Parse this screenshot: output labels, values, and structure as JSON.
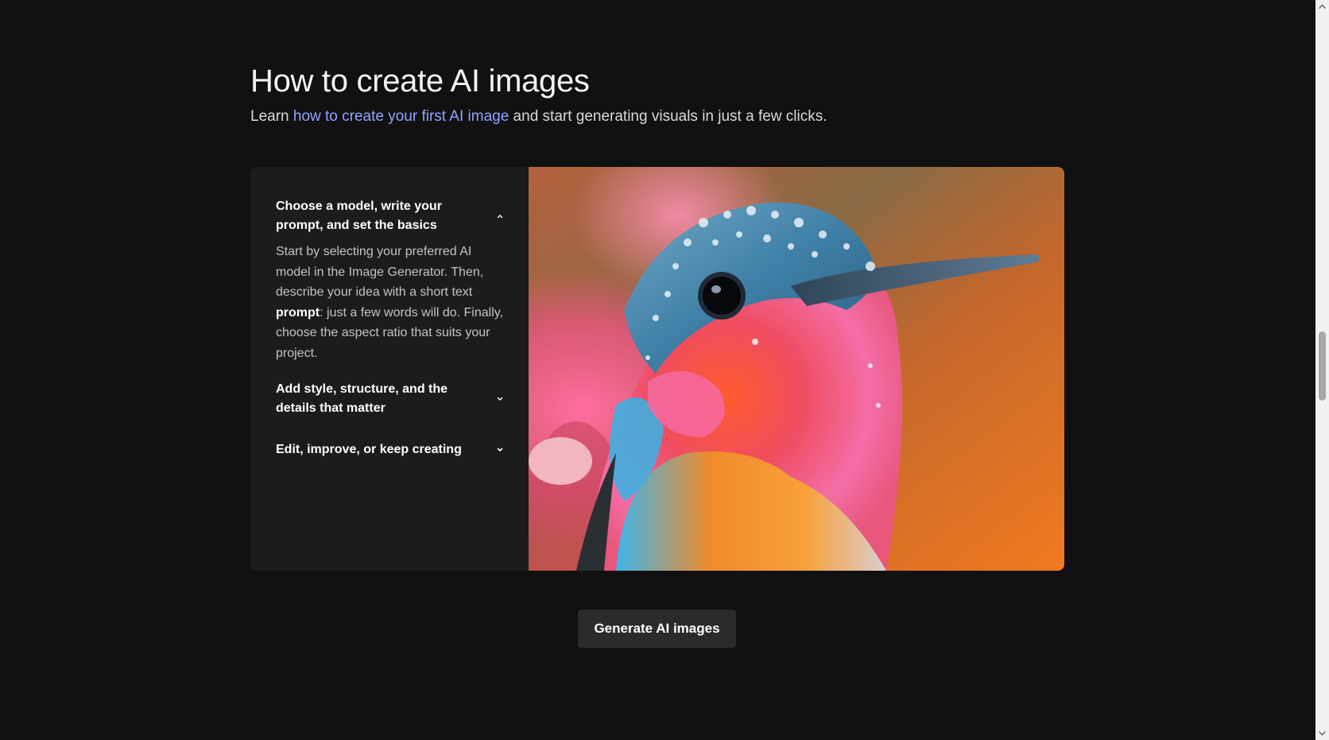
{
  "section": {
    "title": "How to create AI images",
    "intro_prefix": "Learn ",
    "intro_link": "how to create your first AI image",
    "intro_suffix": " and start generating visuals in just a few clicks."
  },
  "accordion": {
    "items": [
      {
        "title": "Choose a model, write your prompt, and set the basics",
        "expanded": true,
        "icon": "chevron-up-icon",
        "body_part1": "Start by selecting your preferred AI model in the Image Generator. Then, describe your idea with a short text ",
        "body_bold": "prompt",
        "body_part2": ": just a few words will do. Finally, choose the aspect ratio that suits your project."
      },
      {
        "title": "Add style, structure, and the details that matter",
        "expanded": false,
        "icon": "chevron-down-icon"
      },
      {
        "title": "Edit, improve, or keep creating",
        "expanded": false,
        "icon": "chevron-down-icon"
      }
    ]
  },
  "image": {
    "subject": "close-up of a colorful hummingbird covered in water droplets"
  },
  "cta": {
    "label": "Generate AI images"
  },
  "colors": {
    "background": "#111112",
    "card": "#1c1c1d",
    "link": "#8ea6ff",
    "button": "#2b2b2d"
  }
}
